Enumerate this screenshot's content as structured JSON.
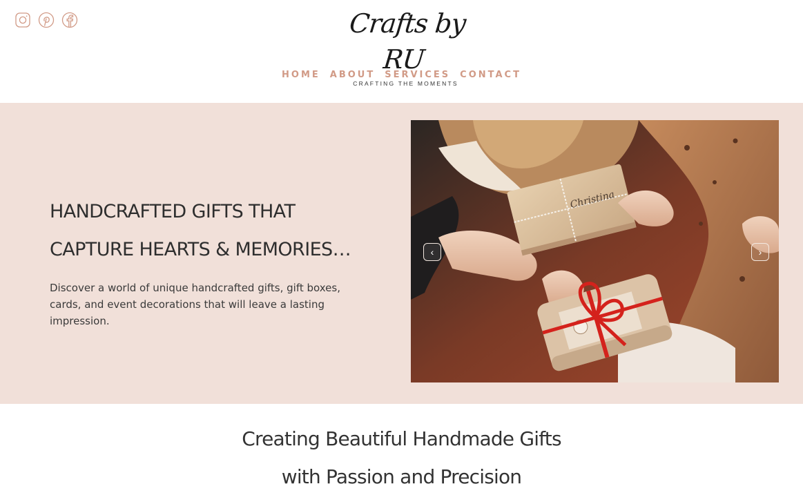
{
  "header": {
    "logo_script": "Crafts by RU",
    "logo_tagline": "CRAFTING THE MOMENTS",
    "social_icons": [
      "instagram-icon",
      "pinterest-icon",
      "facebook-icon"
    ],
    "accent_color": "#d19a86"
  },
  "nav": {
    "items": [
      {
        "label": "HOME"
      },
      {
        "label": "ABOUT"
      },
      {
        "label": "SERVICES"
      },
      {
        "label": "CONTACT"
      }
    ]
  },
  "hero": {
    "background_color": "#f1e0d9",
    "heading_line1": "HANDCRAFTED GIFTS THAT",
    "heading_line2": "CAPTURE  HEARTS & MEMORIES…",
    "description": "Discover a world of unique handcrafted gifts, gift boxes, cards, and event decorations that will leave a lasting impression.",
    "slider": {
      "prev_icon": "chevron-left-icon",
      "next_icon": "chevron-right-icon",
      "prev_glyph": "‹",
      "next_glyph": "›"
    }
  },
  "intro": {
    "title_line1": "Creating Beautiful Handmade Gifts",
    "title_line2": "with Passion and Precision"
  }
}
